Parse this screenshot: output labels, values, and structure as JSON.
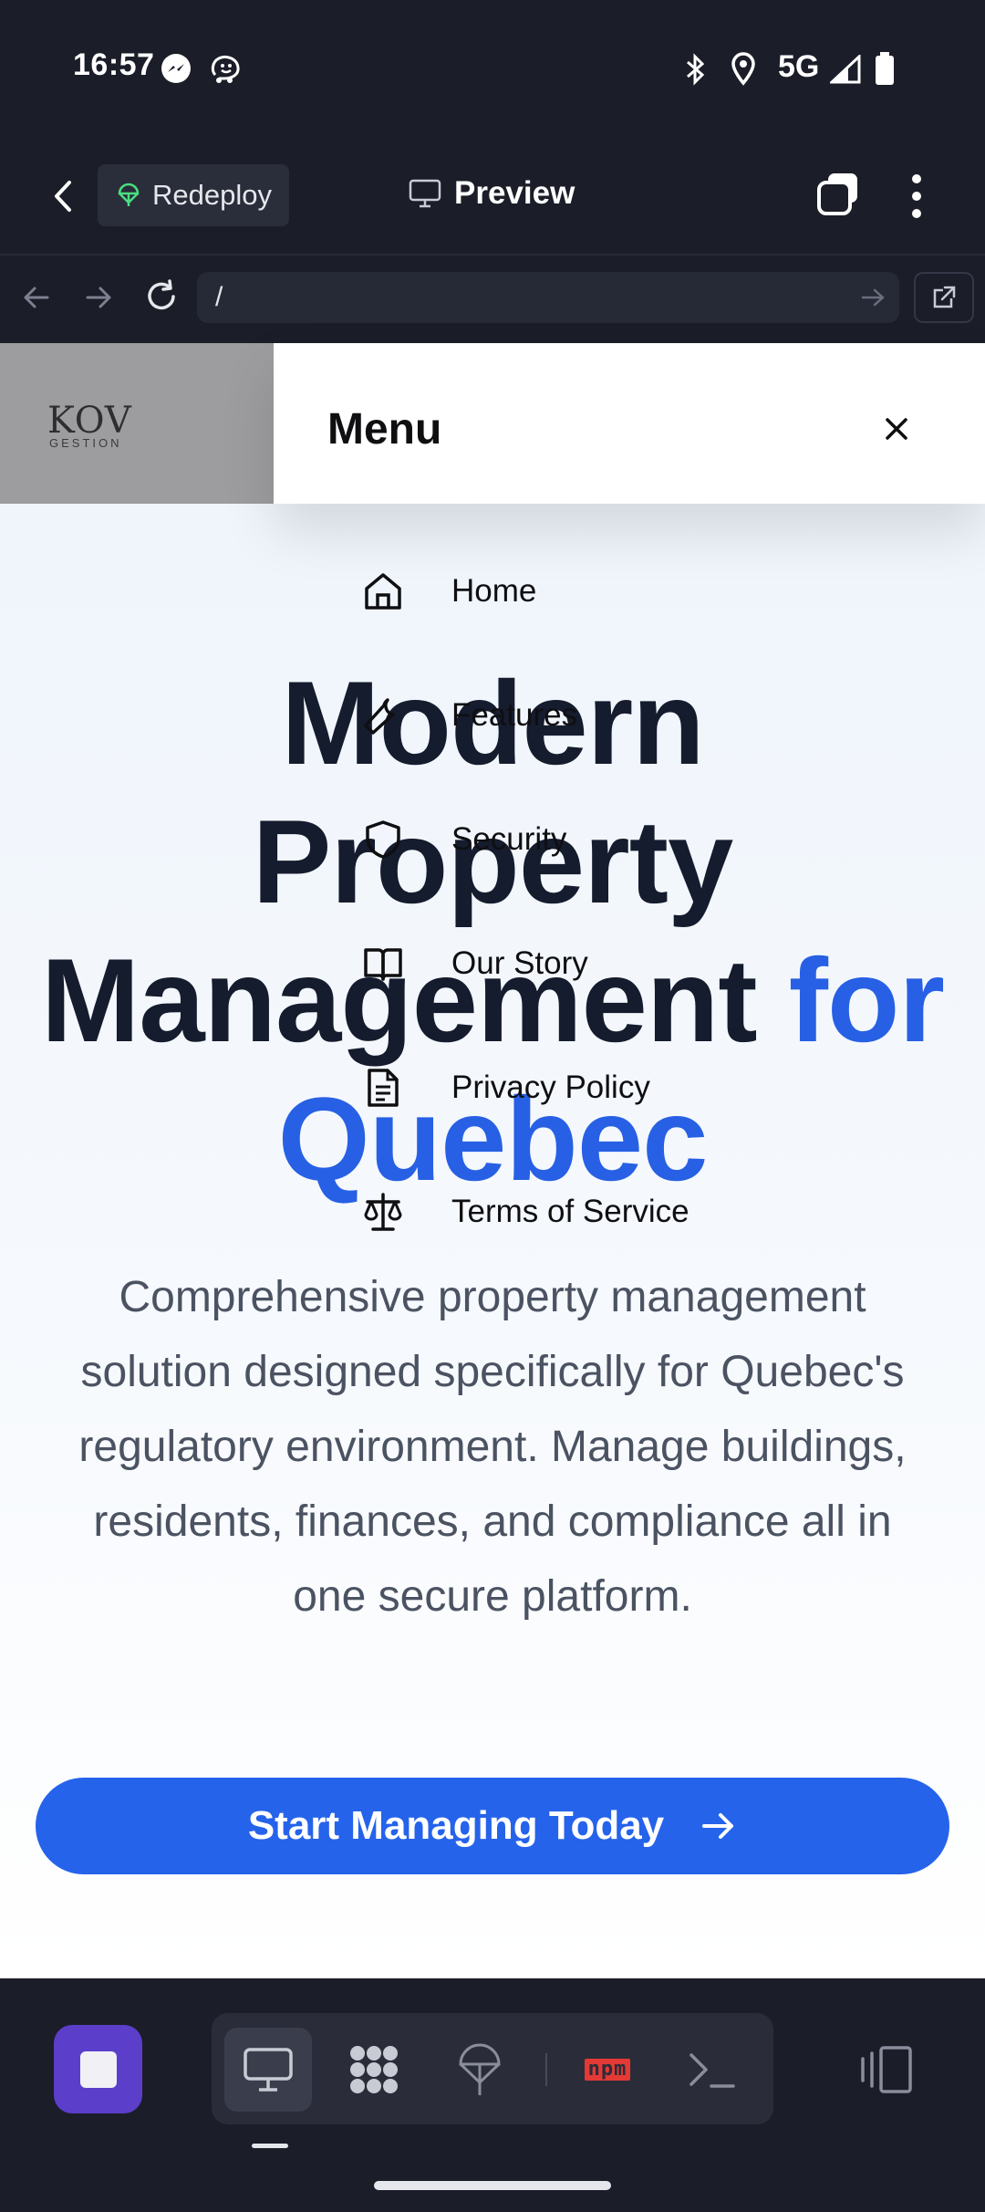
{
  "status_bar": {
    "time": "16:57",
    "network": "5G",
    "icons": [
      "messenger-icon",
      "waze-icon",
      "bluetooth-icon",
      "location-icon",
      "signal-icon",
      "battery-icon"
    ]
  },
  "app_bar": {
    "redeploy_label": "Redeploy",
    "title": "Preview",
    "icons": [
      "back-icon",
      "deploy-icon",
      "monitor-icon",
      "tabs-icon",
      "more-vertical-icon"
    ]
  },
  "browser_bar": {
    "url": "/",
    "icons": [
      "nav-back-icon",
      "nav-forward-icon",
      "reload-icon",
      "go-arrow-icon",
      "open-external-icon"
    ]
  },
  "logo": {
    "text": "KOV",
    "sub": "GESTION"
  },
  "menu": {
    "title": "Menu",
    "items": [
      {
        "label": "Home",
        "icon": "home-icon"
      },
      {
        "label": "Features",
        "icon": "wrench-icon"
      },
      {
        "label": "Security",
        "icon": "shield-icon"
      },
      {
        "label": "Our Story",
        "icon": "book-icon"
      },
      {
        "label": "Privacy Policy",
        "icon": "document-icon"
      },
      {
        "label": "Terms of Service",
        "icon": "scale-icon"
      }
    ]
  },
  "hero": {
    "title_line1": "Modern",
    "title_line2": "Property",
    "title_line3": "Management",
    "title_accent1": "for",
    "title_accent2": "Quebec",
    "description": "Comprehensive property management solution designed specifically for Quebec's regulatory environment. Manage buildings, residents, finances, and compliance all in one secure platform.",
    "cta_label": "Start Managing Today"
  },
  "bottom_bar": {
    "tools": [
      "preview-tool-icon",
      "integrations-tool-icon",
      "deploy-tool-icon",
      "npm-tool-icon",
      "terminal-tool-icon",
      "layout-toggle-icon"
    ],
    "npm_label": "npm",
    "colors": {
      "stop": "#5b3ec9",
      "npm": "#e53935"
    }
  },
  "colors": {
    "accent": "#2563eb",
    "heading": "#151c2e",
    "background": "#1b1d28"
  }
}
